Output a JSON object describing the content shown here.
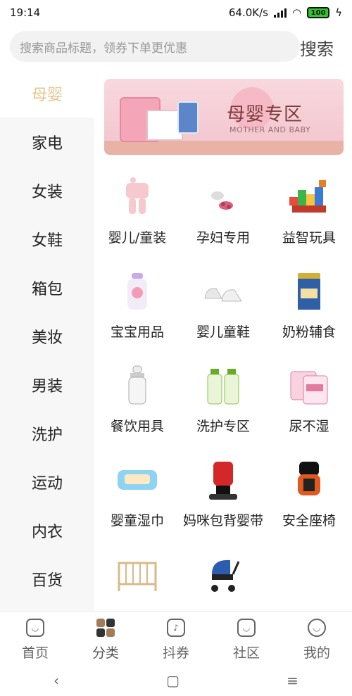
{
  "status": {
    "time": "19:14",
    "speed": "64.0K/s",
    "battery": "100"
  },
  "search": {
    "placeholder": "搜索商品标题，领券下单更优惠",
    "button": "搜索"
  },
  "sidebar": {
    "items": [
      {
        "label": "母婴"
      },
      {
        "label": "家电"
      },
      {
        "label": "女装"
      },
      {
        "label": "女鞋"
      },
      {
        "label": "箱包"
      },
      {
        "label": "美妆"
      },
      {
        "label": "男装"
      },
      {
        "label": "洗护"
      },
      {
        "label": "运动"
      },
      {
        "label": "内衣"
      },
      {
        "label": "百货"
      }
    ]
  },
  "banner": {
    "title": "母婴专区",
    "subtitle": "MOTHER AND BABY"
  },
  "grid": {
    "items": [
      {
        "label": "婴儿/童装"
      },
      {
        "label": "孕妇专用"
      },
      {
        "label": "益智玩具"
      },
      {
        "label": "宝宝用品"
      },
      {
        "label": "婴儿童鞋"
      },
      {
        "label": "奶粉辅食"
      },
      {
        "label": "餐饮用具"
      },
      {
        "label": "洗护专区"
      },
      {
        "label": "尿不湿"
      },
      {
        "label": "婴童湿巾"
      },
      {
        "label": "妈咪包背婴带"
      },
      {
        "label": "安全座椅"
      }
    ]
  },
  "tabs": [
    {
      "label": "首页",
      "icon": "home-icon"
    },
    {
      "label": "分类",
      "icon": "category-icon"
    },
    {
      "label": "抖券",
      "icon": "coupon-icon"
    },
    {
      "label": "社区",
      "icon": "community-icon"
    },
    {
      "label": "我的",
      "icon": "profile-icon"
    }
  ],
  "nav": {
    "back": "‹",
    "home": "▢",
    "menu": "≡"
  },
  "colors": {
    "accent": "#e6c58f",
    "sidebar_bg": "#f7f7f7",
    "banner_pink": "#f3c4cd"
  }
}
